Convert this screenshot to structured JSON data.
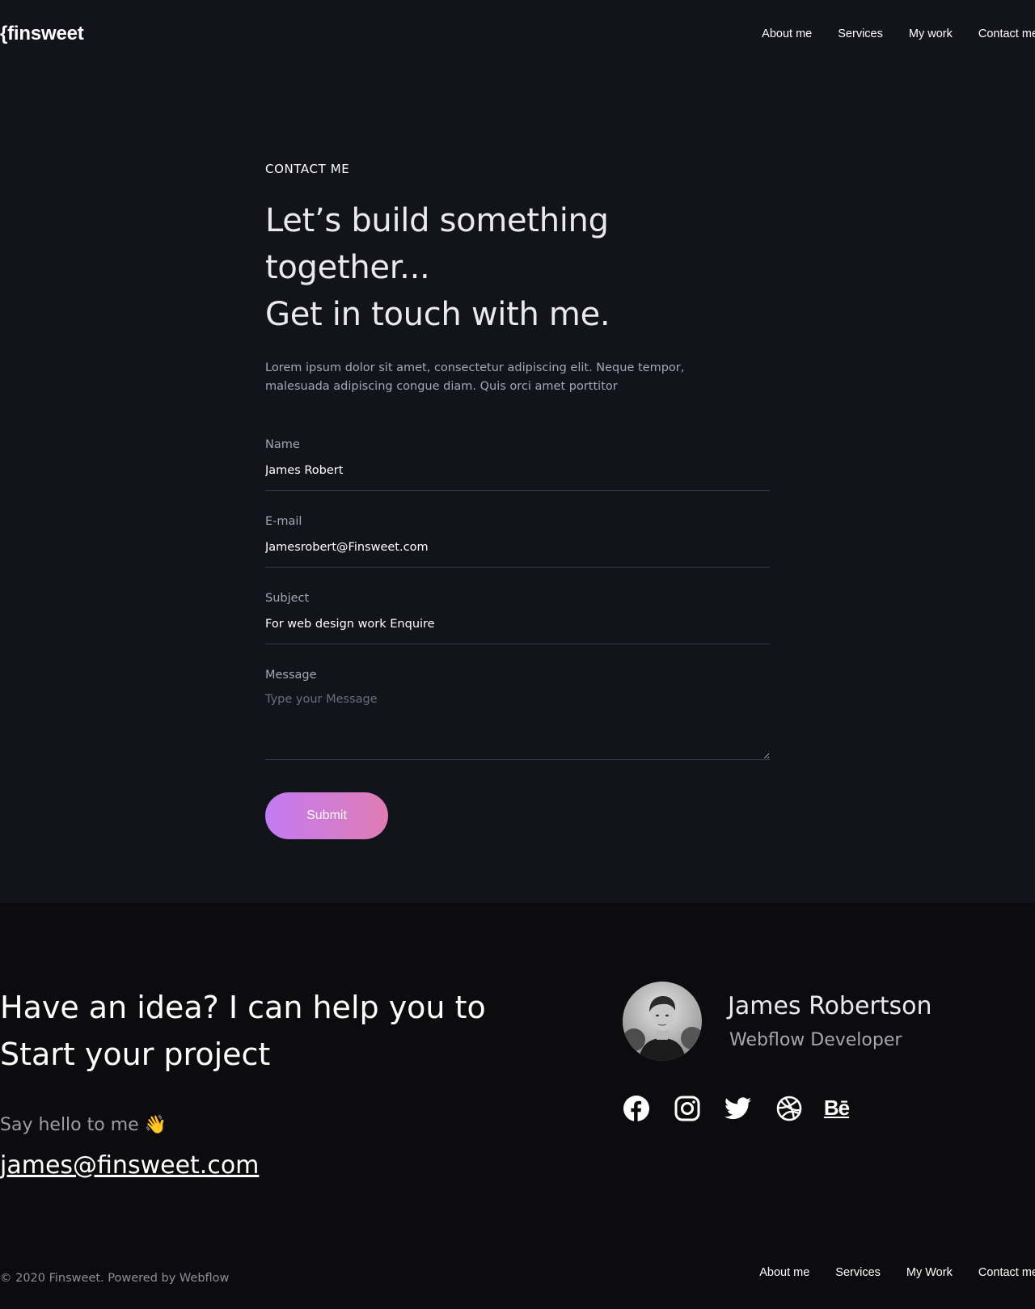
{
  "brand": {
    "logo_text": "{finsweet"
  },
  "nav": {
    "items": [
      {
        "label": "About me"
      },
      {
        "label": "Services"
      },
      {
        "label": "My work"
      },
      {
        "label": "Contact me"
      }
    ]
  },
  "contact": {
    "eyebrow": "CONTACT ME",
    "headline_line1": "Let’s build something together...",
    "headline_line2": "Get in touch with me.",
    "lead": "Lorem ipsum dolor sit amet, consectetur adipiscing elit. Neque tempor, malesuada adipiscing congue diam. Quis orci amet porttitor"
  },
  "form": {
    "name": {
      "label": "Name",
      "value": "James Robert"
    },
    "email": {
      "label": "E-mail",
      "value": "Jamesrobert@Finsweet.com"
    },
    "subject": {
      "label": "Subject",
      "value": "For web design work Enquire"
    },
    "message": {
      "label": "Message",
      "placeholder": "Type your Message"
    },
    "submit_label": "Submit",
    "accent_start": "#c27bf2",
    "accent_end": "#e07cb4"
  },
  "footer": {
    "cta_line1": "Have an idea? I can help you to",
    "cta_line2": "Start your project",
    "hello": "Say hello to me",
    "hello_emoji": "👋",
    "email": "james@finsweet.com",
    "profile": {
      "name": "James Robertson",
      "role": "Webflow Developer",
      "avatar_icon": "person-photo"
    },
    "socials": [
      {
        "icon": "facebook-icon"
      },
      {
        "icon": "instagram-icon"
      },
      {
        "icon": "twitter-icon"
      },
      {
        "icon": "dribbble-icon"
      },
      {
        "icon": "behance-icon",
        "text": "Bē"
      }
    ],
    "copyright": "© 2020 Finsweet. Powered by Webflow",
    "nav": [
      {
        "label": "About me"
      },
      {
        "label": "Services"
      },
      {
        "label": "My Work"
      },
      {
        "label": "Contact me"
      }
    ]
  }
}
